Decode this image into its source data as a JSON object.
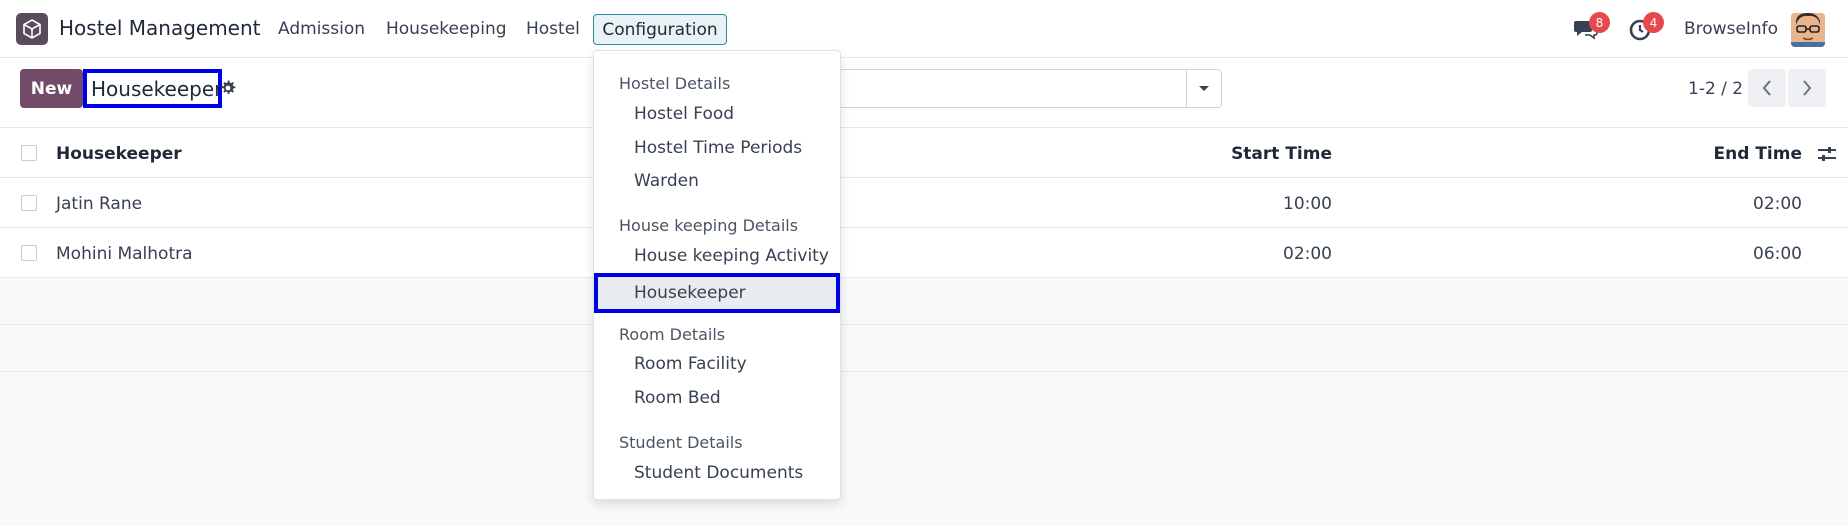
{
  "navbar": {
    "app_name": "Hostel Management",
    "menu": [
      "Admission",
      "Housekeeping",
      "Hostel"
    ],
    "active_menu": "Configuration",
    "messages_count": "8",
    "activities_count": "4",
    "company": "BrowseInfo",
    "badge_color": "#e5484d",
    "accent": "#714b67"
  },
  "control": {
    "new_label": "New",
    "title": "Housekeeper",
    "pager": "1-2 / 2"
  },
  "list": {
    "columns": [
      "Housekeeper",
      "Start Time",
      "End Time"
    ],
    "rows": [
      {
        "name": "Jatin Rane",
        "start": "10:00",
        "end": "02:00"
      },
      {
        "name": "Mohini Malhotra",
        "start": "02:00",
        "end": "06:00"
      }
    ]
  },
  "dropdown": {
    "groups": [
      {
        "title": "Hostel Details",
        "items": [
          "Hostel Food",
          "Hostel Time Periods",
          "Warden"
        ]
      },
      {
        "title": "House keeping Details",
        "items": [
          "House keeping Activity",
          "Housekeeper"
        ]
      },
      {
        "title": "Room Details",
        "items": [
          "Room Facility",
          "Room Bed"
        ]
      },
      {
        "title": "Student Details",
        "items": [
          "Student Documents"
        ]
      }
    ],
    "selected": "Housekeeper"
  }
}
